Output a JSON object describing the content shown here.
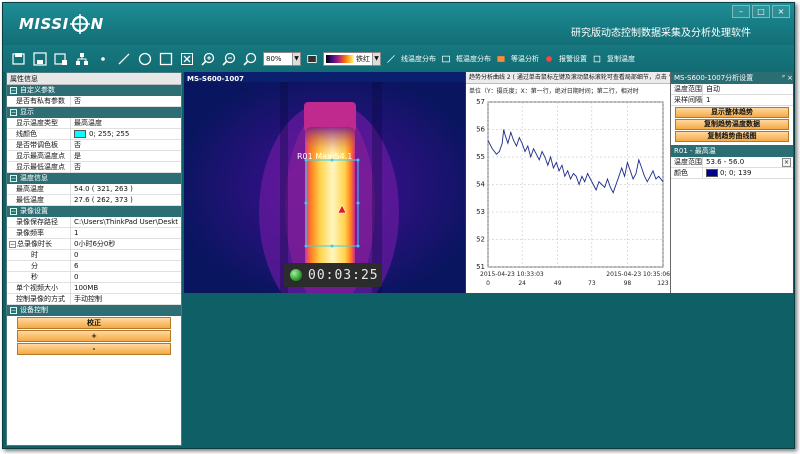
{
  "app": {
    "logo_text": "MISSI  N",
    "title": "研究版动态控制数据采集及分析处理软件",
    "win_buttons": [
      "–",
      "□",
      "×"
    ]
  },
  "toolbar": {
    "icons": [
      "open-file-icon",
      "save-file-icon",
      "save-image-icon",
      "network-icon",
      "point-tool-icon",
      "line-tool-icon",
      "circle-tool-icon",
      "rectangle-tool-icon",
      "delete-icon",
      "zoom-in-icon",
      "zoom-out-icon",
      "zoom-fit-icon"
    ],
    "zoom_value": "80%",
    "palette_label": "铁红",
    "actions": [
      "线温度分布",
      "框温度分布",
      "等温分析",
      "报警设置",
      "复制温度"
    ]
  },
  "left_panel": {
    "header": "属性信息",
    "sections": [
      {
        "title": "自定义参数",
        "rows": [
          {
            "k": "是否有私有参数",
            "v": "否"
          }
        ]
      },
      {
        "title": "显示",
        "rows": [
          {
            "k": "显示温度类型",
            "v": "最高温度"
          },
          {
            "k": "线颜色",
            "v": "0; 255; 255",
            "swatch": "#00ffff"
          },
          {
            "k": "是否带调色板",
            "v": "否"
          },
          {
            "k": "显示最高温度点",
            "v": "是"
          },
          {
            "k": "显示最低温度点",
            "v": "否"
          }
        ]
      },
      {
        "title": "温度信息",
        "rows": [
          {
            "k": "最高温度",
            "v": "54.0 ( 321, 263 )"
          },
          {
            "k": "最低温度",
            "v": "27.6 ( 262, 373 )"
          }
        ]
      },
      {
        "title": "录像设置",
        "rows": [
          {
            "k": "录像保存路径",
            "v": "C:\\Users\\ThinkPad User\\Deskt"
          },
          {
            "k": "录像频率",
            "v": "1"
          },
          {
            "k": "总录像时长",
            "v": "0小时6分0秒",
            "expand": true
          },
          {
            "k": "时",
            "v": "0",
            "sub": true
          },
          {
            "k": "分",
            "v": "6",
            "sub": true
          },
          {
            "k": "秒",
            "v": "0",
            "sub": true
          },
          {
            "k": "单个视频大小",
            "v": "100MB"
          },
          {
            "k": "控制录像的方式",
            "v": "手动控制"
          }
        ]
      },
      {
        "title": "设备控制",
        "buttons": [
          "校正",
          "+",
          "-"
        ]
      }
    ]
  },
  "camera": {
    "title": "MS-S600-1007",
    "roi_label": "R01 Max:54.1",
    "timer": "00:03:25"
  },
  "trend": {
    "header": "趋势分析曲线 2 ( 通过单击鼠标左键及滚动鼠标滚轮可查看局部细节，点击 \"显示整体趋势\" 可...",
    "subheader": "单位（Y：摄氏度；X：第一行，绝对日期时间；第二行，相对时",
    "start_time": "2015-04-23 10:33:03",
    "end_time": "2015-04-23 10:35:06"
  },
  "chart_data": {
    "type": "line",
    "ylim": [
      51,
      57
    ],
    "yticks": [
      51,
      52,
      53,
      54,
      55,
      56,
      57
    ],
    "xticks": [
      0,
      24,
      49,
      73,
      98,
      123
    ],
    "xlim": [
      0,
      123
    ],
    "series": [
      {
        "values": [
          [
            0,
            55.6
          ],
          [
            3,
            55.3
          ],
          [
            6,
            55.1
          ],
          [
            8,
            55.2
          ],
          [
            10,
            55.5
          ],
          [
            11,
            56.0
          ],
          [
            12,
            55.8
          ],
          [
            14,
            55.5
          ],
          [
            16,
            55.9
          ],
          [
            18,
            55.6
          ],
          [
            20,
            55.4
          ],
          [
            22,
            55.7
          ],
          [
            24,
            55.5
          ],
          [
            26,
            55.2
          ],
          [
            28,
            55.4
          ],
          [
            30,
            55.0
          ],
          [
            32,
            55.3
          ],
          [
            34,
            55.1
          ],
          [
            36,
            54.9
          ],
          [
            38,
            55.2
          ],
          [
            40,
            55.0
          ],
          [
            42,
            54.7
          ],
          [
            44,
            55.0
          ],
          [
            46,
            54.6
          ],
          [
            48,
            54.8
          ],
          [
            50,
            54.5
          ],
          [
            52,
            54.7
          ],
          [
            54,
            54.3
          ],
          [
            56,
            54.5
          ],
          [
            58,
            54.2
          ],
          [
            60,
            54.4
          ],
          [
            62,
            54.3
          ],
          [
            64,
            54.0
          ],
          [
            66,
            54.3
          ],
          [
            68,
            54.1
          ],
          [
            70,
            54.4
          ],
          [
            72,
            54.2
          ],
          [
            74,
            54.0
          ],
          [
            76,
            53.8
          ],
          [
            78,
            54.1
          ],
          [
            80,
            54.0
          ],
          [
            82,
            53.9
          ],
          [
            84,
            54.2
          ],
          [
            86,
            53.9
          ],
          [
            88,
            53.7
          ],
          [
            90,
            54.0
          ],
          [
            92,
            54.3
          ],
          [
            94,
            54.6
          ],
          [
            96,
            54.3
          ],
          [
            98,
            54.8
          ],
          [
            100,
            54.5
          ],
          [
            102,
            54.2
          ],
          [
            104,
            54.4
          ],
          [
            106,
            54.9
          ],
          [
            108,
            54.6
          ],
          [
            110,
            54.3
          ],
          [
            112,
            54.1
          ],
          [
            114,
            54.3
          ],
          [
            116,
            54.5
          ],
          [
            118,
            54.2
          ],
          [
            120,
            54.3
          ],
          [
            123,
            54.1
          ]
        ]
      }
    ]
  },
  "right_panel": {
    "settings_header": "MS-S600-1007分析设置",
    "pin": "ᴾ ×",
    "settings_rows": [
      {
        "k": "温度范围",
        "v": "自动"
      },
      {
        "k": "采样间隔",
        "v": "1"
      }
    ],
    "buttons": [
      "显示整体趋势",
      "复制趋势温度数据",
      "复制趋势曲线图"
    ],
    "roi_header": "R01 - 最高温",
    "roi_rows": [
      {
        "k": "温度范围",
        "v": "53.6 - 56.0",
        "x": "×"
      },
      {
        "k": "颜色",
        "v": "0; 0; 139",
        "swatch": "#00008b"
      }
    ]
  }
}
